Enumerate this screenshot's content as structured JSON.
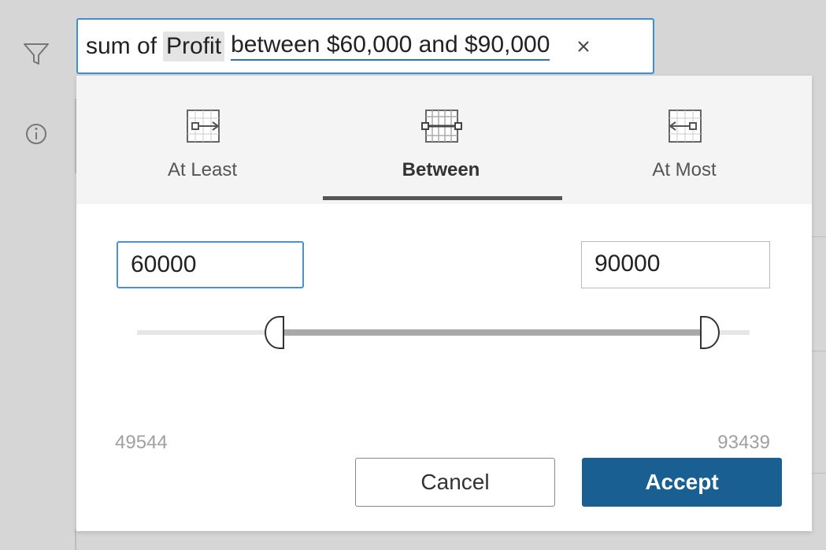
{
  "colors": {
    "accent_blue": "#3f8fd8",
    "accept_bg": "#1a5f91",
    "tab_indicator": "#555555",
    "slider_fill": "#a9a9a9"
  },
  "left_rail": {
    "icons": [
      "filter-icon",
      "info-icon"
    ]
  },
  "query": {
    "prefix": "sum of",
    "field": "Profit",
    "condition": "between $60,000 and $90,000",
    "close_icon": "close-icon"
  },
  "tabs": [
    {
      "label": "At Least",
      "icon": "at-least-icon",
      "active": false
    },
    {
      "label": "Between",
      "icon": "between-icon",
      "active": true
    },
    {
      "label": "At Most",
      "icon": "at-most-icon",
      "active": false
    }
  ],
  "range": {
    "min_input": "60000",
    "max_input": "90000",
    "domain_min": "49544",
    "domain_max": "93439",
    "selected_min_value": 60000,
    "selected_max_value": 90000
  },
  "buttons": {
    "cancel": "Cancel",
    "accept": "Accept"
  }
}
